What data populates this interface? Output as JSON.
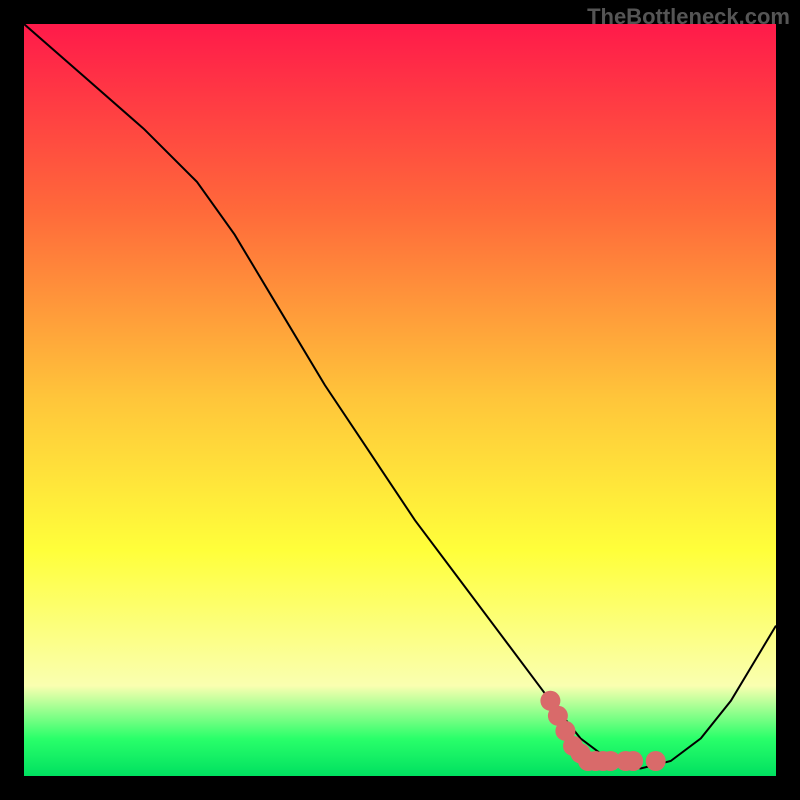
{
  "watermark": "TheBottleneck.com",
  "chart_data": {
    "type": "line",
    "title": "",
    "xlabel": "",
    "ylabel": "",
    "xlim": [
      0,
      100
    ],
    "ylim": [
      0,
      100
    ],
    "grid": false,
    "legend": false,
    "gradient_stops": [
      {
        "pos": 0.0,
        "color": "#ff1a4a"
      },
      {
        "pos": 0.25,
        "color": "#ff6a3a"
      },
      {
        "pos": 0.5,
        "color": "#ffc63a"
      },
      {
        "pos": 0.7,
        "color": "#ffff3a"
      },
      {
        "pos": 0.88,
        "color": "#faffb0"
      },
      {
        "pos": 0.95,
        "color": "#2aff6a"
      },
      {
        "pos": 1.0,
        "color": "#00e060"
      }
    ],
    "series": [
      {
        "name": "bottleneck-curve",
        "color": "#000000",
        "width": 2,
        "x": [
          0,
          8,
          16,
          23,
          28,
          34,
          40,
          46,
          52,
          58,
          64,
          70,
          74,
          78,
          82,
          86,
          90,
          94,
          100
        ],
        "y": [
          100,
          93,
          86,
          79,
          72,
          62,
          52,
          43,
          34,
          26,
          18,
          10,
          5,
          2,
          1,
          2,
          5,
          10,
          20
        ]
      }
    ],
    "highlight_points": {
      "name": "highlight",
      "color": "#d96a6a",
      "x": [
        70,
        71,
        72,
        73,
        74,
        75,
        76,
        77,
        78,
        80,
        81,
        84
      ],
      "y": [
        10,
        8,
        6,
        4,
        3,
        2,
        2,
        2,
        2,
        2,
        2,
        2
      ],
      "size": 10
    }
  }
}
